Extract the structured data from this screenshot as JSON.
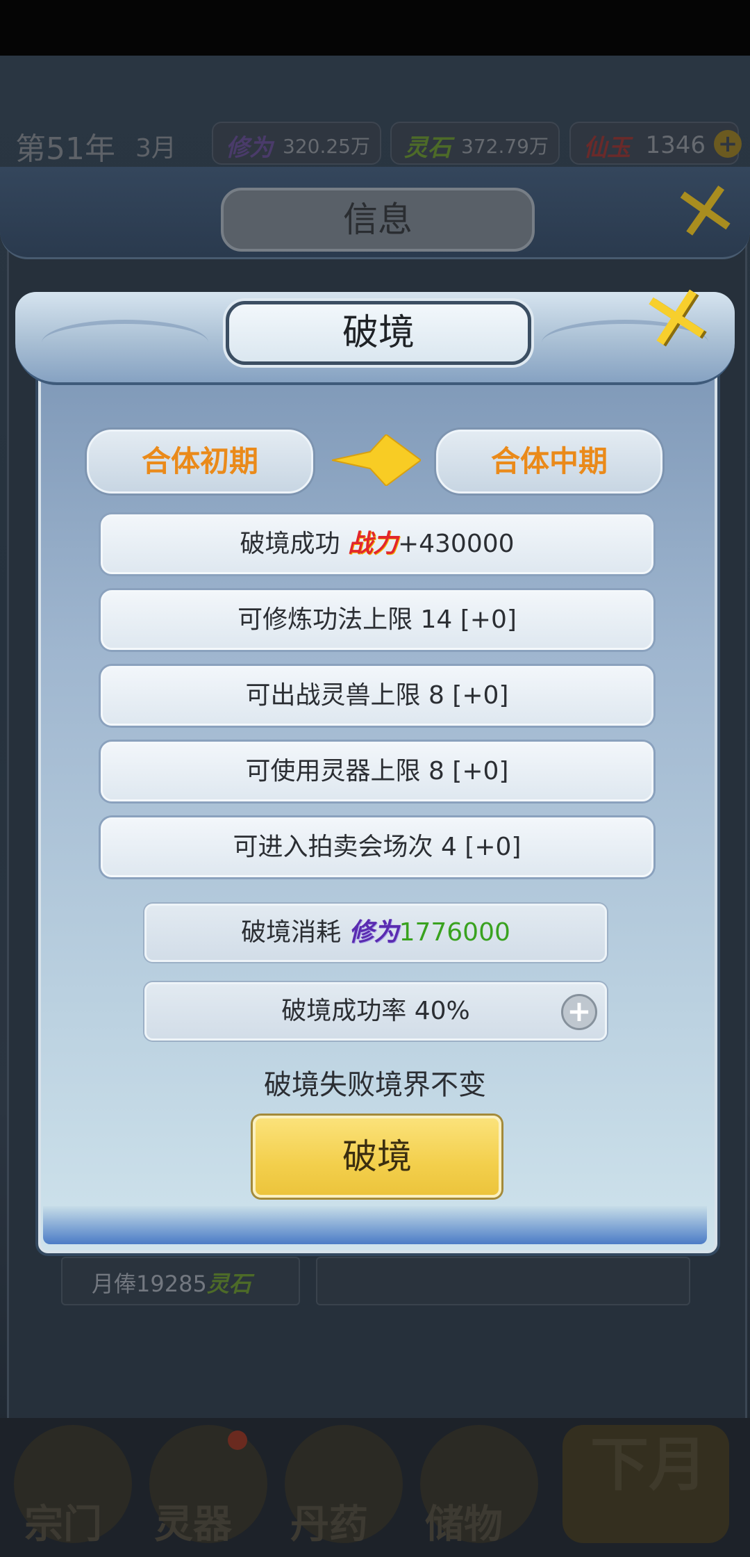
{
  "background": {
    "year": "第51年",
    "month": "3月",
    "resources": [
      {
        "name": "修为",
        "value": "320.25万",
        "color": "#4a3b6a"
      },
      {
        "name": "灵石",
        "value": "372.79万",
        "color": "#4d6b28"
      },
      {
        "name": "仙玉",
        "value": "1346",
        "color": "#6a2a2a"
      }
    ],
    "outer_title": "信息",
    "salary": {
      "text": "月俸19285",
      "unit": "灵石"
    },
    "nav": [
      "宗门",
      "灵器",
      "丹药",
      "储物"
    ],
    "next_month": "下月"
  },
  "dialog": {
    "title": "破境",
    "from_realm": "合体初期",
    "to_realm": "合体中期",
    "effects": [
      {
        "prefix": "破境成功 ",
        "tag": "战力",
        "suffix": "+430000"
      },
      {
        "text": "可修炼功法上限 14 [+0]"
      },
      {
        "text": "可出战灵兽上限 8 [+0]"
      },
      {
        "text": "可使用灵器上限 8 [+0]"
      },
      {
        "text": "可进入拍卖会场次 4 [+0]"
      }
    ],
    "cost": {
      "prefix": "破境消耗 ",
      "tag": "修为",
      "value": "1776000"
    },
    "success_rate": "破境成功率 40%",
    "note": "破境失败境界不变",
    "action_label": "破境"
  },
  "colors": {
    "realm_text": "#ea8a1a",
    "accent_gold": "#f3cf4c",
    "cost_value": "#39a21f"
  }
}
